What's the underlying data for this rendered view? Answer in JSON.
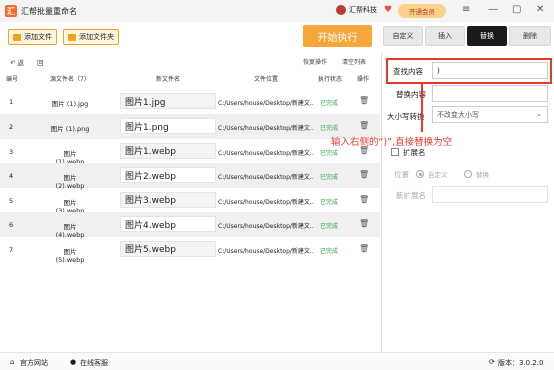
{
  "app": {
    "title": "汇帮批量重命名",
    "logo_icon": "app-logo-icon",
    "brand": "汇帮科技",
    "vip": "开通会员"
  },
  "toolbar": {
    "add_file": "添加文件",
    "add_folder": "添加文件夹",
    "start": "开始执行"
  },
  "tabs": [
    {
      "label": "自定义",
      "active": false
    },
    {
      "label": "插入",
      "active": false
    },
    {
      "label": "替换",
      "active": true
    },
    {
      "label": "删除",
      "active": false
    }
  ],
  "list_actions": {
    "undo": "↶ 返",
    "redo": "回",
    "restore": "恢复操作",
    "clear": "清空列表"
  },
  "table": {
    "headers": {
      "idx": "编号",
      "src": "源文件名（7）",
      "new": "新文件名",
      "path": "文件位置",
      "status": "执行状态",
      "op": "操作"
    },
    "rows": [
      {
        "idx": "1",
        "src": "图片 (1).jpg",
        "new": "图片1.jpg",
        "path": "C:/Users/house/Desktop/新建文...",
        "status": "已完成"
      },
      {
        "idx": "2",
        "src": "图片 (1).png",
        "new": "图片1.png",
        "path": "C:/Users/house/Desktop/新建文...",
        "status": "已完成"
      },
      {
        "idx": "3",
        "src": "图片 (1).webp",
        "new": "图片1.webp",
        "path": "C:/Users/house/Desktop/新建文...",
        "status": "已完成"
      },
      {
        "idx": "4",
        "src": "图片 (2).webp",
        "new": "图片2.webp",
        "path": "C:/Users/house/Desktop/新建文...",
        "status": "已完成"
      },
      {
        "idx": "5",
        "src": "图片 (3).webp",
        "new": "图片3.webp",
        "path": "C:/Users/house/Desktop/新建文...",
        "status": "已完成"
      },
      {
        "idx": "6",
        "src": "图片 (4).webp",
        "new": "图片4.webp",
        "path": "C:/Users/house/Desktop/新建文...",
        "status": "已完成"
      },
      {
        "idx": "7",
        "src": "图片 (5).webp",
        "new": "图片5.webp",
        "path": "C:/Users/house/Desktop/新建文...",
        "status": "已完成"
      }
    ]
  },
  "replace_panel": {
    "find_label": "查找内容",
    "find_value": ")",
    "replace_label": "替换内容",
    "replace_value": "",
    "case_label": "大小写转换",
    "case_value": "不改变大小写",
    "ext_label": "扩展名",
    "position_label": "位置",
    "position_opt1": "自定义",
    "position_opt2": "替换",
    "new_ext_label": "新扩展名",
    "new_ext_value": ""
  },
  "annotation": "输入右侧的“)”,直接替换为空",
  "footer": {
    "website": "官方网站",
    "service": "在线客服",
    "version": "版本：3.0.2.0"
  },
  "colors": {
    "accent": "#f8a83b",
    "annotation": "#e43a2a",
    "done": "#2ea44f"
  }
}
